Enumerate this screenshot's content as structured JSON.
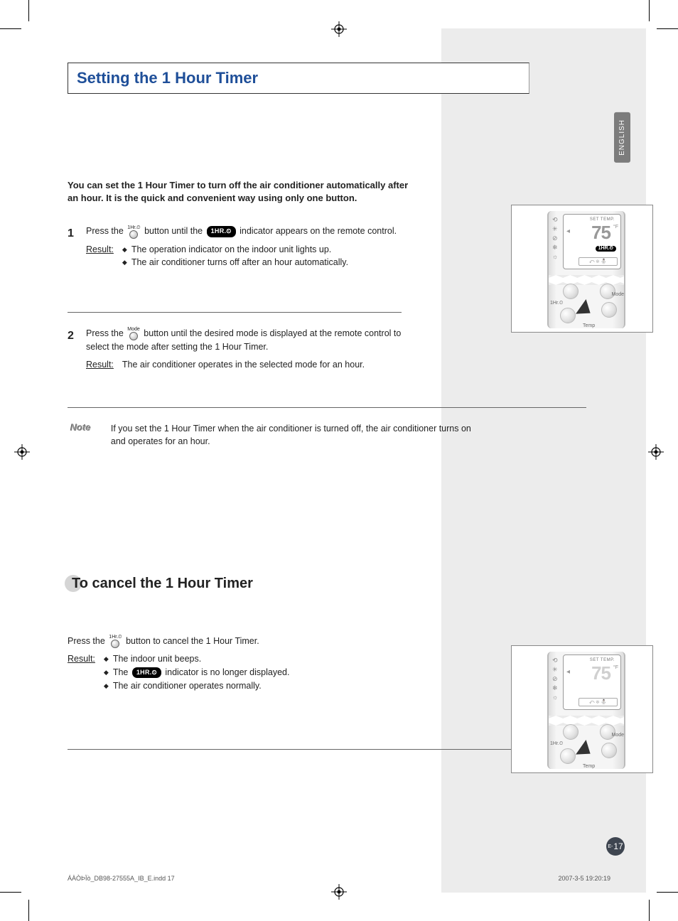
{
  "lang_tab": "ENGLISH",
  "title": "Setting the 1 Hour Timer",
  "intro": "You can set the 1 Hour Timer to turn off the air conditioner automatically after an hour. It is the quick and convenient way using only one button.",
  "indicator_label": "1HR.⏲",
  "icon_labels": {
    "onehr": "1Hr.⏲",
    "mode": "Mode"
  },
  "step1": {
    "num": "1",
    "text_a": "Press the",
    "text_b": "button until the",
    "text_c": "indicator appears on the remote control.",
    "result_label": "Result:",
    "bullets": [
      "The operation indicator on the indoor unit lights up.",
      "The air conditioner turns off after an hour automatically."
    ]
  },
  "step2": {
    "num": "2",
    "text_a": "Press the",
    "text_b": "button until the desired mode is displayed at the remote control to select the mode after setting the 1 Hour Timer.",
    "result_label": "Result:",
    "result_text": "The air conditioner operates in the selected mode for an hour."
  },
  "note": {
    "label": "Note",
    "text": "If you set the 1 Hour Timer when the air conditioner is turned off, the air conditioner turns on and operates for an hour."
  },
  "subtitle": "To cancel the 1 Hour Timer",
  "cancel": {
    "text_a": "Press the",
    "text_b": "button to cancel the 1 Hour Timer.",
    "result_label": "Result:",
    "bullets": [
      "The indoor unit beeps.",
      "The ‡ indicator is no longer displayed.",
      "The air conditioner operates normally."
    ]
  },
  "remote": {
    "set_temp_label": "SET TEMP.",
    "temp_value": "75",
    "onehr_pill": "1HR.⏲",
    "btn_onehr": "1Hr.⏲",
    "btn_mode": "Mode",
    "btn_temp": "Temp"
  },
  "page_prefix": "E-",
  "page_num": "17",
  "footer_left": "ÁÀÒÞÏò_DB98-27555A_IB_E.indd   17",
  "footer_right": "2007-3-5   19:20:19"
}
